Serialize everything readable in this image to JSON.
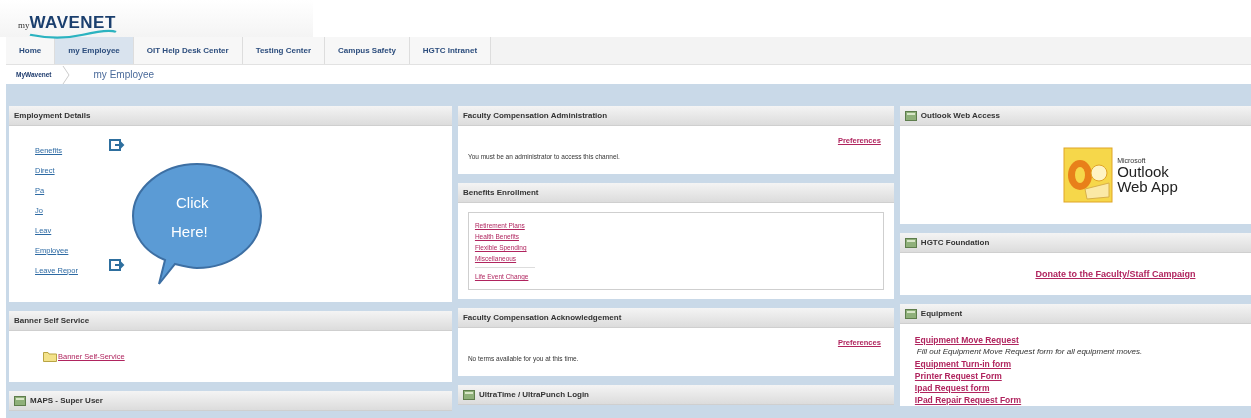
{
  "logo": {
    "prefix": "my",
    "name": "WAVENET"
  },
  "tabs": [
    {
      "label": "Home",
      "selected": false
    },
    {
      "label": "my Employee",
      "selected": true
    },
    {
      "label": "OIT Help Desk Center",
      "selected": false
    },
    {
      "label": "Testing Center",
      "selected": false
    },
    {
      "label": "Campus Safety",
      "selected": false
    },
    {
      "label": "HGTC Intranet",
      "selected": false
    }
  ],
  "breadcrumb": {
    "root": "MyWavenet",
    "current": "my Employee"
  },
  "columns": [
    {
      "channels": [
        {
          "kind": "links",
          "title": "Employment Details",
          "has_icon": false,
          "links": [
            {
              "label": "Benefits",
              "launch_icon": true
            },
            {
              "label": "Direct",
              "launch_icon": false
            },
            {
              "label": "Pa",
              "launch_icon": false
            },
            {
              "label": "Jo",
              "launch_icon": false
            },
            {
              "label": "Leav",
              "launch_icon": false
            },
            {
              "label": "Employee",
              "launch_icon": false
            },
            {
              "label": "Leave Repor",
              "launch_icon": true
            }
          ],
          "callout": {
            "line1": "Click",
            "line2": "Here!"
          }
        },
        {
          "kind": "folder",
          "title": "Banner Self Service",
          "has_icon": false,
          "link": "Banner Self-Service"
        },
        {
          "kind": "empty",
          "title": "MAPS - Super User",
          "has_icon": true
        }
      ]
    },
    {
      "channels": [
        {
          "kind": "message",
          "title": "Faculty Compensation Administration",
          "has_icon": false,
          "preferences": "Preferences",
          "message": "You must be an administrator to access this channel."
        },
        {
          "kind": "box",
          "title": "Benefits Enrollment",
          "has_icon": false,
          "groups": [
            [
              "Retirement Plans",
              "Health Benefits",
              "Flexible Spending",
              "Miscellaneous"
            ],
            [
              "Life Event Change"
            ]
          ]
        },
        {
          "kind": "message",
          "title": "Faculty Compensation Acknowledgement",
          "has_icon": false,
          "preferences": "Preferences",
          "message": "No terms available for you at this time."
        },
        {
          "kind": "empty",
          "title": "UltraTime / UltraPunch Login",
          "has_icon": true
        }
      ]
    },
    {
      "channels": [
        {
          "kind": "outlook",
          "title": "Outlook Web Access",
          "has_icon": true,
          "brand": "Microsoft",
          "product1": "Outlook",
          "product2": "Web App"
        },
        {
          "kind": "center_link",
          "title": "HGTC Foundation",
          "has_icon": true,
          "link": "Donate to the Faculty/Staff Campaign"
        },
        {
          "kind": "list",
          "title": "Equipment",
          "has_icon": true,
          "items": [
            {
              "label": "Equipment Move Request",
              "kind": "link"
            },
            {
              "label": "Fill out Equipment Move Request form for all equipment moves.",
              "kind": "note"
            },
            {
              "label": "Equipment Turn-in form",
              "kind": "link"
            },
            {
              "label": "Printer Request Form",
              "kind": "link"
            },
            {
              "label": "Ipad Request form",
              "kind": "link"
            },
            {
              "label": "IPad Repair Request Form",
              "kind": "link"
            }
          ]
        }
      ]
    }
  ]
}
